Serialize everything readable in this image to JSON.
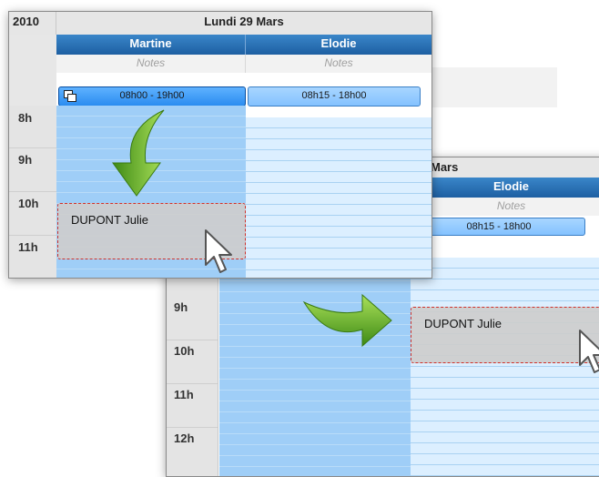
{
  "app": {
    "year": "2010",
    "date": "Lundi 29 Mars",
    "date_partial": "Mars"
  },
  "employees": [
    {
      "name": "Martine",
      "notes": "Notes",
      "shift": "08h00 - 19h00"
    },
    {
      "name": "Elodie",
      "notes": "Notes",
      "shift": "08h15 - 18h00"
    }
  ],
  "front_panel": {
    "hours": [
      "8h",
      "9h",
      "10h",
      "11h"
    ],
    "event_label": "DUPONT Julie"
  },
  "back_panel": {
    "hours": [
      "9h",
      "10h",
      "11h",
      "12h"
    ],
    "event_label": "DUPONT Julie"
  },
  "icons": [
    "copy-icon",
    "curved-arrow-down-icon",
    "curved-arrow-right-icon",
    "mouse-pointer-icon"
  ],
  "colors": {
    "header_blue": "#1d5fa2",
    "active_shift": "#2a8cf0",
    "slot_dark": "#9fcef7",
    "slot_light": "#dcefff",
    "event_border": "#d0302a",
    "arrow_green": "#5aa21e"
  }
}
